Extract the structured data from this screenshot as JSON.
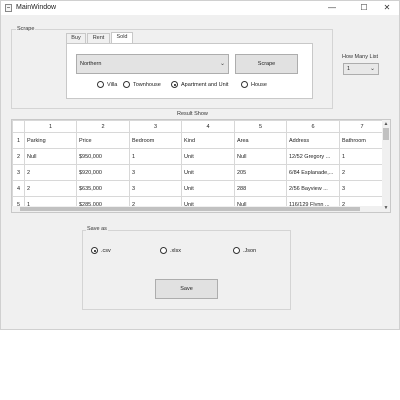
{
  "window": {
    "title": "MainWindow",
    "controls": {
      "minimize": "—",
      "maximize": "☐",
      "close": "✕"
    }
  },
  "scrape_group": {
    "label": "Scrape",
    "tabs": [
      {
        "label": "Buy",
        "active": false
      },
      {
        "label": "Rent",
        "active": false
      },
      {
        "label": "Sold",
        "active": true
      }
    ],
    "region_select": "Northern",
    "scrape_button": "Scrape",
    "property_types": [
      {
        "label": "Villa",
        "checked": false
      },
      {
        "label": "Townhouse",
        "checked": false
      },
      {
        "label": "Apartment and Unit",
        "checked": true
      },
      {
        "label": "House",
        "checked": false
      }
    ]
  },
  "how_many": {
    "label": "How Many List",
    "value": "1"
  },
  "results": {
    "label": "Result Show",
    "column_numbers": [
      "1",
      "2",
      "3",
      "4",
      "5",
      "6",
      "7"
    ],
    "row_numbers": [
      "1",
      "2",
      "3",
      "4",
      "5"
    ],
    "rows": [
      [
        "Parking",
        "Price",
        "Bedroom",
        "Kind",
        "Area",
        "Address",
        "Bathroom"
      ],
      [
        "Null",
        "$950,000",
        "1",
        "Unit",
        "Null",
        "12/52 Gregory ...",
        "1"
      ],
      [
        "2",
        "$920,000",
        "3",
        "Unit",
        "205",
        "6/84 Esplanade,...",
        "2"
      ],
      [
        "2",
        "$635,000",
        "3",
        "Unit",
        "288",
        "2/56 Bayview ...",
        "3"
      ],
      [
        "1",
        "$285,000",
        "2",
        "Unit",
        "Null",
        "116/129 Flynn ...",
        "2"
      ]
    ]
  },
  "save_group": {
    "label": "Save as",
    "formats": [
      {
        "label": ".csv",
        "checked": true
      },
      {
        "label": ".xlsx",
        "checked": false
      },
      {
        "label": ".Json",
        "checked": false
      }
    ],
    "save_button": "Save"
  }
}
